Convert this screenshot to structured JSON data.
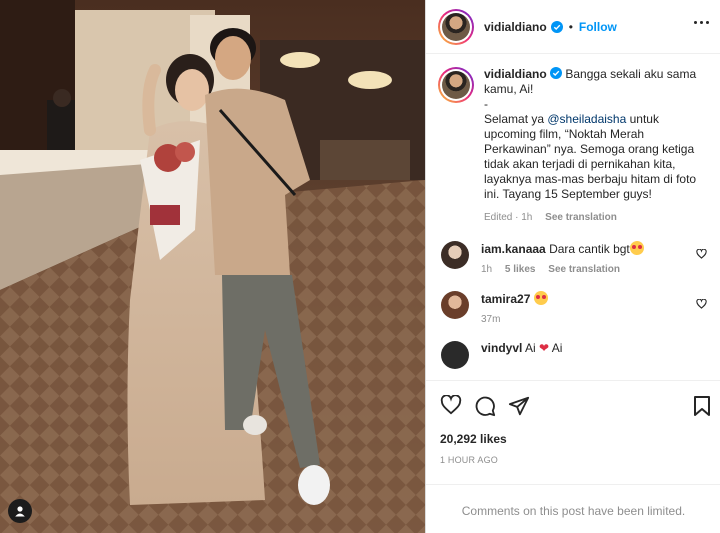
{
  "post": {
    "username": "vidialdiano",
    "follow_label": "Follow",
    "header_separator": "•",
    "caption_line1": "Bangga sekali aku sama kamu, Ai!",
    "caption_dash": "-",
    "caption_pre_mention": "Selamat ya ",
    "caption_mention": "@sheiladaisha",
    "caption_post_mention": " untuk upcoming film, “Noktah Merah Perkawinan” nya. Semoga orang ketiga tidak akan terjadi di pernikahan kita, layaknya mas-mas berbaju hitam di foto ini. Tayang 15 September guys!",
    "edited_label": "Edited · 1h",
    "see_translation": "See translation"
  },
  "comments": [
    {
      "username": "iam.kanaaa",
      "text": "Dara cantik bgt",
      "time": "1h",
      "likes": "5 likes",
      "translate": "See translation"
    },
    {
      "username": "tamira27",
      "text": "",
      "time": "37m"
    },
    {
      "username": "vindyvl",
      "text": "Ai",
      "text2": "Ai"
    }
  ],
  "footer": {
    "likes": "20,292 likes",
    "timestamp": "1 HOUR AGO",
    "comments_limited": "Comments on this post have been limited."
  },
  "colors": {
    "accent": "#0095f6",
    "mention": "#00376b",
    "muted": "#8e8e8e"
  }
}
